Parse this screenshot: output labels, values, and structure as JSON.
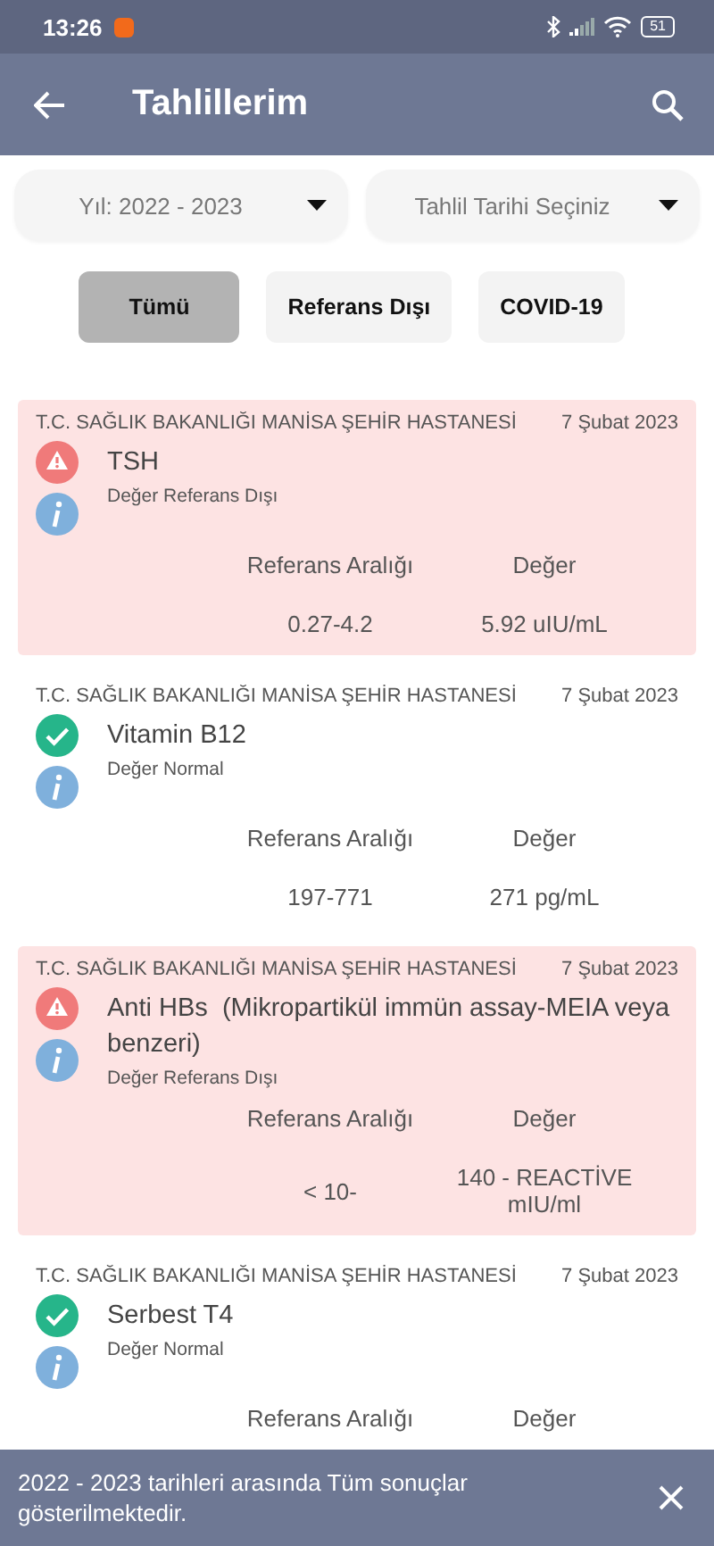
{
  "status_bar": {
    "time": "13:26",
    "battery": "51"
  },
  "app_bar": {
    "title": "Tahlillerim"
  },
  "filters": [
    {
      "label": "Yıl: 2022 - 2023"
    },
    {
      "label": "Tahlil Tarihi Seçiniz"
    }
  ],
  "chips": [
    {
      "label": "Tümü",
      "selected": true
    },
    {
      "label": "Referans Dışı",
      "selected": false
    },
    {
      "label": "COVID-19",
      "selected": false
    }
  ],
  "results": [
    {
      "hospital": "T.C. SAĞLIK BAKANLIĞI MANİSA ŞEHİR HASTANESİ",
      "date": "7 Şubat 2023",
      "name": "TSH",
      "kind": "abnormal",
      "status_text": "Değer Referans Dışı",
      "range_header": "Referans Aralığı",
      "value_header": "Değer",
      "range": "0.27-4.2",
      "value": "5.92 uIU/mL"
    },
    {
      "hospital": "T.C. SAĞLIK BAKANLIĞI MANİSA ŞEHİR HASTANESİ",
      "date": "7 Şubat 2023",
      "name": "Vitamin B12",
      "kind": "normal",
      "status_text": "Değer Normal",
      "range_header": "Referans Aralığı",
      "value_header": "Değer",
      "range": "197-771",
      "value": "271 pg/mL"
    },
    {
      "hospital": "T.C. SAĞLIK BAKANLIĞI MANİSA ŞEHİR HASTANESİ",
      "date": "7 Şubat 2023",
      "name": "Anti HBs  (Mikropartikül immün assay-MEIA veya benzeri)",
      "kind": "abnormal",
      "status_text": "Değer Referans Dışı",
      "range_header": "Referans Aralığı",
      "value_header": "Değer",
      "range": "< 10-",
      "value": "140 - REACTİVE mIU/ml"
    },
    {
      "hospital": "T.C. SAĞLIK BAKANLIĞI MANİSA ŞEHİR HASTANESİ",
      "date": "7 Şubat 2023",
      "name": "Serbest T4",
      "kind": "normal",
      "status_text": "Değer Normal",
      "range_header": "Referans Aralığı",
      "value_header": "Değer"
    }
  ],
  "snackbar": {
    "message": "2022 - 2023 tarihleri arasında Tüm sonuçlar gösterilmektedir."
  }
}
